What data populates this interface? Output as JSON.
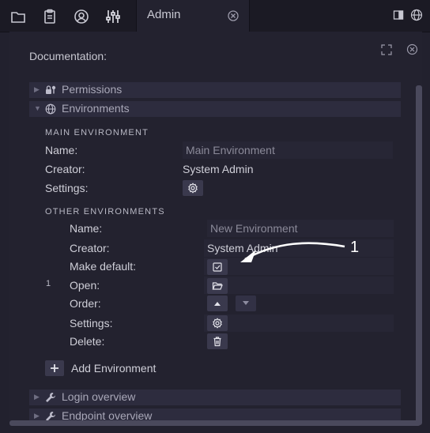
{
  "toolbar": {
    "icons": [
      "folder-icon",
      "clipboard-icon",
      "user-circle-icon",
      "sliders-icon"
    ],
    "tab_label": "Admin",
    "right_icons": [
      "panel-icon",
      "globe-icon"
    ]
  },
  "panel": {
    "doc_label": "Documentation:"
  },
  "sections": {
    "permissions": "Permissions",
    "environments": "Environments",
    "login_overview": "Login overview",
    "endpoint_overview": "Endpoint overview"
  },
  "main_env": {
    "heading": "MAIN ENVIRONMENT",
    "name_label": "Name:",
    "name_value": "Main Environment",
    "creator_label": "Creator:",
    "creator_value": "System Admin",
    "settings_label": "Settings:"
  },
  "other_env": {
    "heading": "OTHER ENVIRONMENTS",
    "index": "1",
    "name_label": "Name:",
    "name_value": "New Environment",
    "creator_label": "Creator:",
    "creator_value": "System Admin",
    "make_default_label": "Make default:",
    "open_label": "Open:",
    "order_label": "Order:",
    "settings_label": "Settings:",
    "delete_label": "Delete:",
    "add_label": "Add Environment"
  },
  "annotation": {
    "number": "1"
  },
  "colors": {
    "background": "#22212e",
    "toolbar": "#1b1a24",
    "section_bar": "#2d2c3e",
    "button": "#3a394d"
  }
}
